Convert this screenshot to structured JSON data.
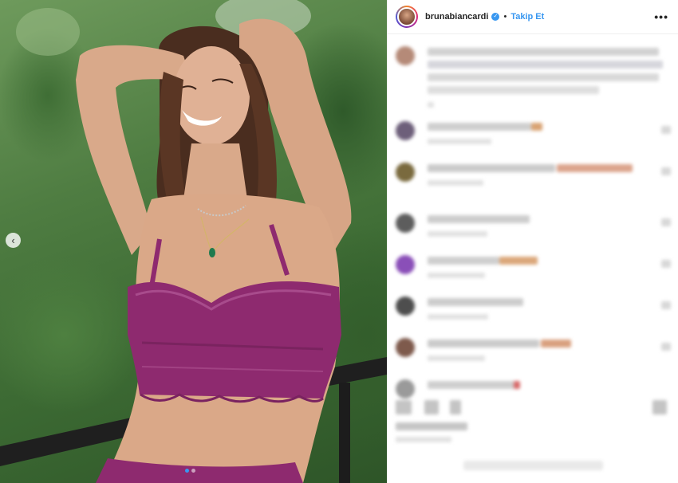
{
  "post": {
    "username": "brunabiancardi",
    "verified_icon": "verified-badge-icon",
    "separator": "•",
    "follow_label": "Takip Et",
    "more_label": "•••"
  },
  "carousel": {
    "prev_label": "‹",
    "total_images": 2,
    "active_index": 1
  },
  "colors": {
    "follow_blue": "#3897f0",
    "bra": "#8e2a6f",
    "foliage": "#4f7d42"
  }
}
